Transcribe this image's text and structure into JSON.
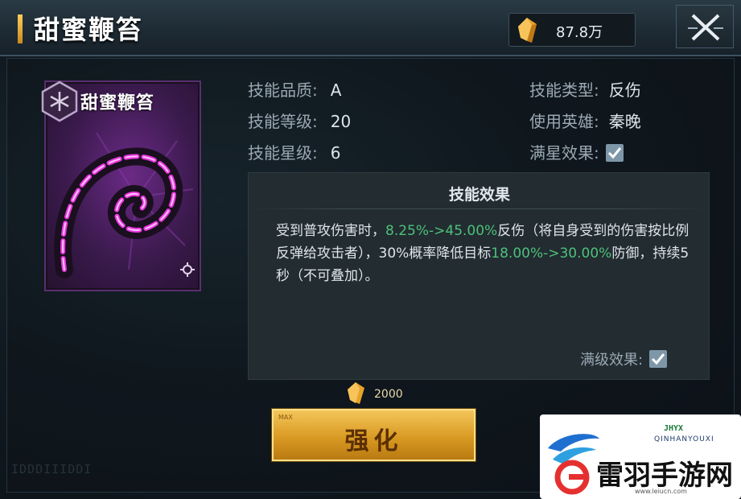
{
  "header": {
    "title": "甜蜜鞭笞",
    "currency_value": "87.8万"
  },
  "card": {
    "name": "甜蜜鞭笞"
  },
  "stats": {
    "quality_label": "技能品质:",
    "quality_value": "A",
    "level_label": "技能等级:",
    "level_value": "20",
    "star_label": "技能星级:",
    "star_value": "6",
    "type_label": "技能类型:",
    "type_value": "反伤",
    "hero_label": "使用英雄:",
    "hero_value": "秦晚",
    "full_star_label": "满星效果:",
    "full_star_checked": true
  },
  "effect": {
    "title": "技能效果",
    "seg1": "受到普攻伤害时，",
    "seg2": "8.25%->45.00%",
    "seg3": "反伤（将自身受到的伤害按比例反弹给攻击者），30%概率降低目标",
    "seg4": "18.00%->30.00%",
    "seg5": "防御，持续5秒（不可叠加）。",
    "max_level_label": "满级效果:",
    "max_level_checked": true
  },
  "upgrade": {
    "cost": "2000",
    "button_label": "强化",
    "button_tag": "MAX"
  },
  "footer": {
    "code_text": "IDDDIIIDDI"
  },
  "watermark": {
    "brand_small": "JHYX",
    "brand_pinyin": "QINHANYOUXI",
    "site_name": "雷羽手游网",
    "site_url": "www.leiucn.com"
  },
  "colors": {
    "highlight_green": "#4ec07a",
    "button_gold": "#d99a23",
    "card_purple": "#6b2a86"
  }
}
